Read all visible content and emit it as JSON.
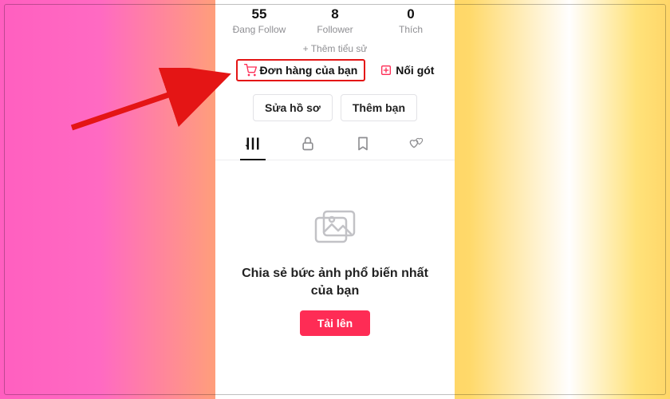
{
  "stats": {
    "following": {
      "count": "55",
      "label": "Đang Follow"
    },
    "followers": {
      "count": "8",
      "label": "Follower"
    },
    "likes": {
      "count": "0",
      "label": "Thích"
    }
  },
  "add_bio": "+ Thêm tiểu sử",
  "links": {
    "orders": "Đơn hàng của bạn",
    "follow": "Nối gót"
  },
  "buttons": {
    "edit_profile": "Sửa hồ sơ",
    "add_friends": "Thêm bạn"
  },
  "empty_state": {
    "title": "Chia sẻ bức ảnh phổ biến nhất của bạn",
    "upload": "Tải lên"
  }
}
